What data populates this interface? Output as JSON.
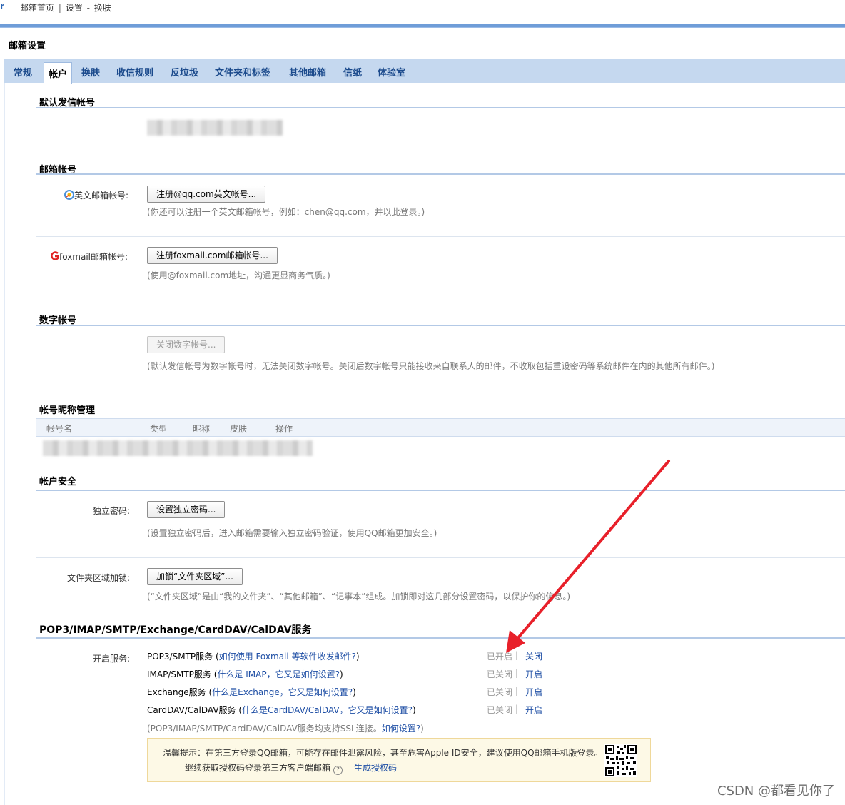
{
  "breadcrumb": {
    "home": "邮箱首页",
    "settings": "设置",
    "current": "换肤",
    "dash": "-"
  },
  "page_title": "邮箱设置",
  "tabs": [
    {
      "label": "常规"
    },
    {
      "label": "帐户"
    },
    {
      "label": "换肤"
    },
    {
      "label": "收信规则"
    },
    {
      "label": "反垃圾"
    },
    {
      "label": "文件夹和标签"
    },
    {
      "label": "其他邮箱"
    },
    {
      "label": "信纸"
    },
    {
      "label": "体验室"
    }
  ],
  "default_sender": {
    "title": "默认发信帐号"
  },
  "mail_account": {
    "title": "邮箱帐号",
    "english": {
      "label": "英文邮箱帐号:",
      "button": "注册@qq.com英文帐号...",
      "hint": "(你还可以注册一个英文邮箱帐号，例如：chen@qq.com，并以此登录。)"
    },
    "foxmail": {
      "label": "foxmail邮箱帐号:",
      "button": "注册foxmail.com邮箱帐号...",
      "hint": "(使用@foxmail.com地址，沟通更显商务气质。)"
    }
  },
  "digital_account": {
    "title": "数字帐号",
    "button": "关闭数字帐号...",
    "hint": "(默认发信帐号为数字帐号时，无法关闭数字帐号。关闭后数字帐号只能接收来自联系人的邮件，不收取包括重设密码等系统邮件在内的其他所有邮件。)"
  },
  "nickname_mgmt": {
    "title": "帐号昵称管理",
    "columns": [
      "帐号名",
      "类型",
      "昵称",
      "皮肤",
      "操作"
    ]
  },
  "security": {
    "title": "帐户安全",
    "independent_pwd": {
      "label": "独立密码:",
      "button": "设置独立密码...",
      "hint": "(设置独立密码后，进入邮箱需要输入独立密码验证，使用QQ邮箱更加安全。)"
    },
    "folder_lock": {
      "label": "文件夹区域加锁:",
      "button": "加锁“文件夹区域”...",
      "hint": "(“文件夹区域”是由“我的文件夹”、“其他邮箱”、“记事本”组成。加锁即对这几部分设置密码，以保护你的信息。)"
    }
  },
  "services": {
    "title": "POP3/IMAP/SMTP/Exchange/CardDAV/CalDAV服务",
    "label": "开启服务:",
    "items": [
      {
        "name": "POP3/SMTP服务",
        "link": "如何使用 Foxmail 等软件收发邮件?",
        "status": "已开启",
        "action": "关闭"
      },
      {
        "name": "IMAP/SMTP服务",
        "link": "什么是 IMAP，它又是如何设置?",
        "status": "已关闭",
        "action": "开启"
      },
      {
        "name": "Exchange服务",
        "link": "什么是Exchange，它又是如何设置?",
        "status": "已关闭",
        "action": "开启"
      },
      {
        "name": "CardDAV/CalDAV服务",
        "link": "什么是CardDAV/CalDAV，它又是如何设置?",
        "status": "已关闭",
        "action": "开启"
      }
    ],
    "ssl_note": "(POP3/IMAP/SMTP/CardDAV/CalDAV服务均支持SSL连接。",
    "ssl_link": "如何设置?",
    "ssl_close": ")",
    "tip_line1": "温馨提示：在第三方登录QQ邮箱，可能存在邮件泄露风险，甚至危害Apple ID安全，建议使用QQ邮箱手机版登录。",
    "tip_line2": "继续获取授权码登录第三方客户端邮箱",
    "tip_link": "生成授权码"
  },
  "watermark": "CSDN @都看见你了",
  "colors": {
    "accent": "#1f4fa5",
    "tab_bar": "#c5d8ef",
    "arrow": "#e8202a",
    "tip_bg": "#fdf9e6"
  },
  "icons": {
    "qq": "qq-circle-icon",
    "foxmail": "foxmail-g-icon",
    "help": "question-circle-icon",
    "qr": "qr-code-icon"
  }
}
